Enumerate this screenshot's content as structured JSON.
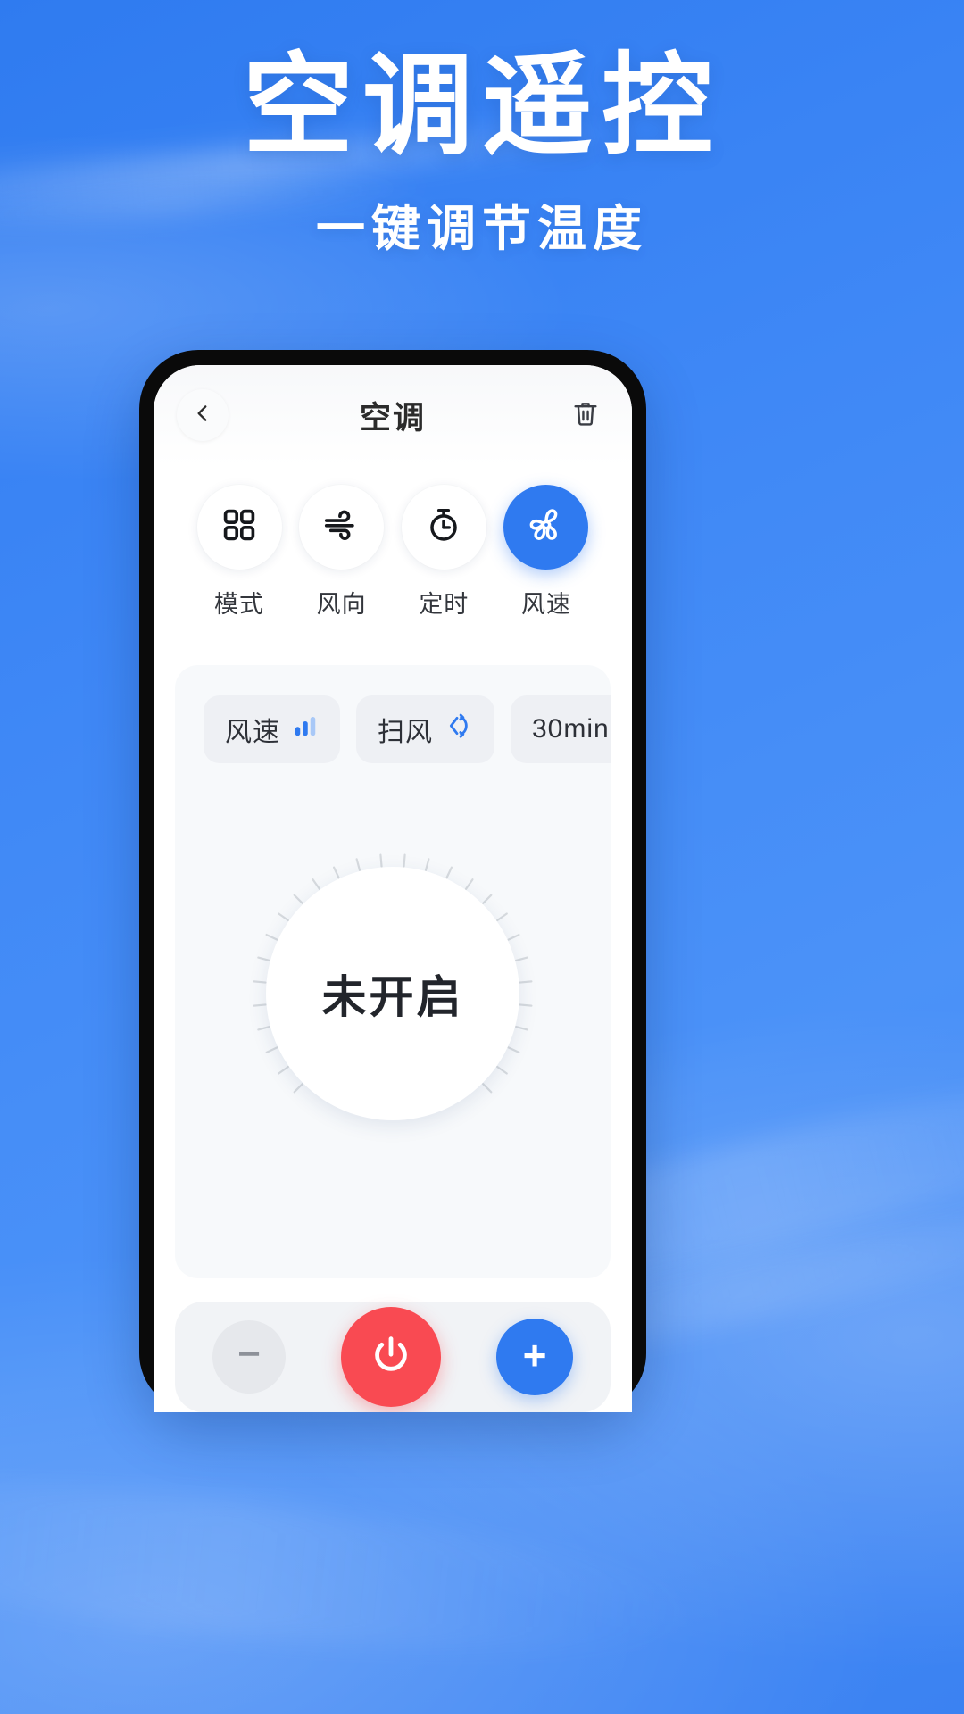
{
  "hero": {
    "title": "空调遥控",
    "subtitle": "一键调节温度"
  },
  "theme": {
    "background_blue": "#3d86f5",
    "accent_blue": "#2f7af0",
    "power_red": "#f94a52",
    "panel_gray": "#f7f9fb",
    "chip_gray": "#eef0f4",
    "track_gray": "#e3e6ea"
  },
  "phone": {
    "header": {
      "back_icon": "chevron-left-icon",
      "title": "空调",
      "delete_icon": "trash-icon"
    },
    "modes": [
      {
        "label": "模式",
        "icon": "grid-icon",
        "active": false
      },
      {
        "label": "风向",
        "icon": "wind-icon",
        "active": false
      },
      {
        "label": "定时",
        "icon": "stopwatch-icon",
        "active": false
      },
      {
        "label": "风速",
        "icon": "fan-icon",
        "active": true
      }
    ],
    "chips": [
      {
        "label": "风速",
        "icon": "signal-bars-icon"
      },
      {
        "label": "扫风",
        "icon": "swing-arrows-icon"
      },
      {
        "label": "30min",
        "icon": "timer-icon"
      }
    ],
    "dial": {
      "status_text": "未开启",
      "arc_percent": 75,
      "arc_sweep_degrees": 270,
      "arc_start_degrees": 135,
      "tick_count": 28
    },
    "controls": [
      {
        "name": "decrease-button",
        "label": "−",
        "color": "#e6e8ec"
      },
      {
        "name": "power-button",
        "label": "",
        "color": "#f94a52"
      },
      {
        "name": "increase-button",
        "label": "+",
        "color": "#2f7af0"
      }
    ]
  }
}
